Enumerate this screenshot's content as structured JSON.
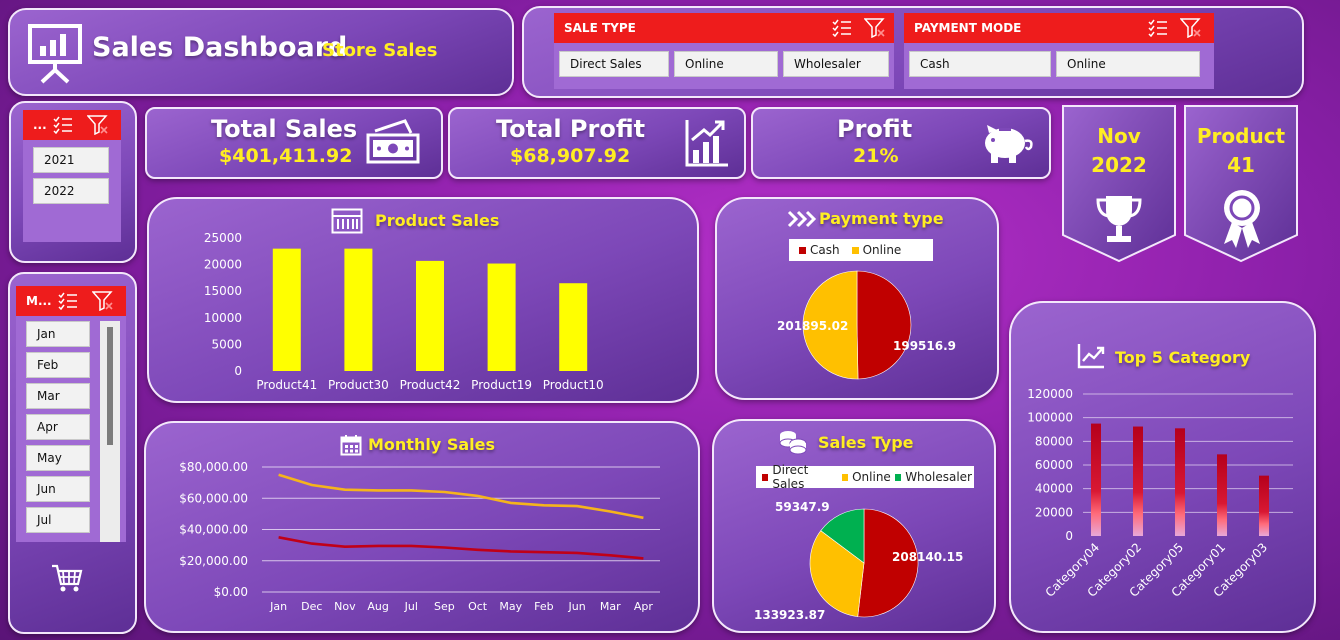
{
  "header": {
    "title": "Sales Dashboard",
    "subtitle": "Store Sales"
  },
  "sale_type_slicer": {
    "label": "SALE TYPE",
    "options": [
      "Direct Sales",
      "Online",
      "Wholesaler"
    ]
  },
  "payment_slicer": {
    "label": "PAYMENT MODE",
    "options": [
      "Cash",
      "Online"
    ]
  },
  "year_slicer": {
    "label": "...",
    "options": [
      "2021",
      "2022"
    ]
  },
  "month_slicer": {
    "label": "M...",
    "options": [
      "Jan",
      "Feb",
      "Mar",
      "Apr",
      "May",
      "Jun",
      "Jul"
    ]
  },
  "kpis": {
    "total_sales_label": "Total Sales",
    "total_sales_value": "$401,411.92",
    "total_profit_label": "Total Profit",
    "total_profit_value": "$68,907.92",
    "profit_label": "Profit",
    "profit_value": "21%"
  },
  "badges": {
    "month_line1": "Nov",
    "month_line2": "2022",
    "product_line1": "Product",
    "product_line2": "41"
  },
  "colors": {
    "accent_yellow": "#ffee22",
    "slicer_red": "#ee1c1c",
    "cash": "#c00000",
    "online": "#ffc000",
    "wholesaler": "#00b050",
    "bar_yellow": "#ffff00",
    "line_sales": "#f5b41c",
    "line_profit": "#c00018"
  },
  "chart_data": [
    {
      "id": "product_sales",
      "type": "bar",
      "title": "Product Sales",
      "categories": [
        "Product41",
        "Product30",
        "Product42",
        "Product19",
        "Product10"
      ],
      "values": [
        23000,
        23000,
        20700,
        20200,
        16500
      ],
      "yticks": [
        "25000",
        "20000",
        "15000",
        "10000",
        "5000",
        "0"
      ],
      "ylim": [
        0,
        25000
      ]
    },
    {
      "id": "payment_type",
      "type": "pie",
      "title": "Payment type",
      "labels": [
        "Cash",
        "Online"
      ],
      "values": [
        199516.9,
        201895.02
      ],
      "value_labels": [
        "199516.9",
        "201895.02"
      ]
    },
    {
      "id": "monthly_sales",
      "type": "line",
      "title": "Monthly Sales",
      "categories": [
        "Jan",
        "Dec",
        "Nov",
        "Aug",
        "Jul",
        "Sep",
        "Oct",
        "May",
        "Feb",
        "Jun",
        "Mar",
        "Apr"
      ],
      "series": [
        {
          "values": [
            75000,
            68500,
            65500,
            65000,
            65000,
            64000,
            61500,
            57000,
            55500,
            55000,
            51500,
            47500
          ]
        },
        {
          "values": [
            35000,
            31000,
            29000,
            29500,
            29500,
            28500,
            27000,
            26000,
            25500,
            25000,
            23500,
            21500
          ]
        }
      ],
      "yticks": [
        "$80,000.00",
        "$60,000.00",
        "$40,000.00",
        "$20,000.00",
        "$0.00"
      ],
      "ylim": [
        0,
        80000
      ]
    },
    {
      "id": "sales_type",
      "type": "pie",
      "title": "Sales Type",
      "labels": [
        "Direct Sales",
        "Online",
        "Wholesaler"
      ],
      "values": [
        208140.15,
        133923.87,
        59347.9
      ],
      "value_labels": [
        "208140.15",
        "133923.87",
        "59347.9"
      ]
    },
    {
      "id": "top5_category",
      "type": "bar",
      "title": "Top 5 Category",
      "categories": [
        "Category04",
        "Category02",
        "Category05",
        "Category01",
        "Category03"
      ],
      "values": [
        95000,
        92500,
        91000,
        69000,
        51000
      ],
      "yticks": [
        "120000",
        "100000",
        "80000",
        "60000",
        "40000",
        "20000",
        "0"
      ],
      "ylim": [
        0,
        120000
      ]
    }
  ]
}
